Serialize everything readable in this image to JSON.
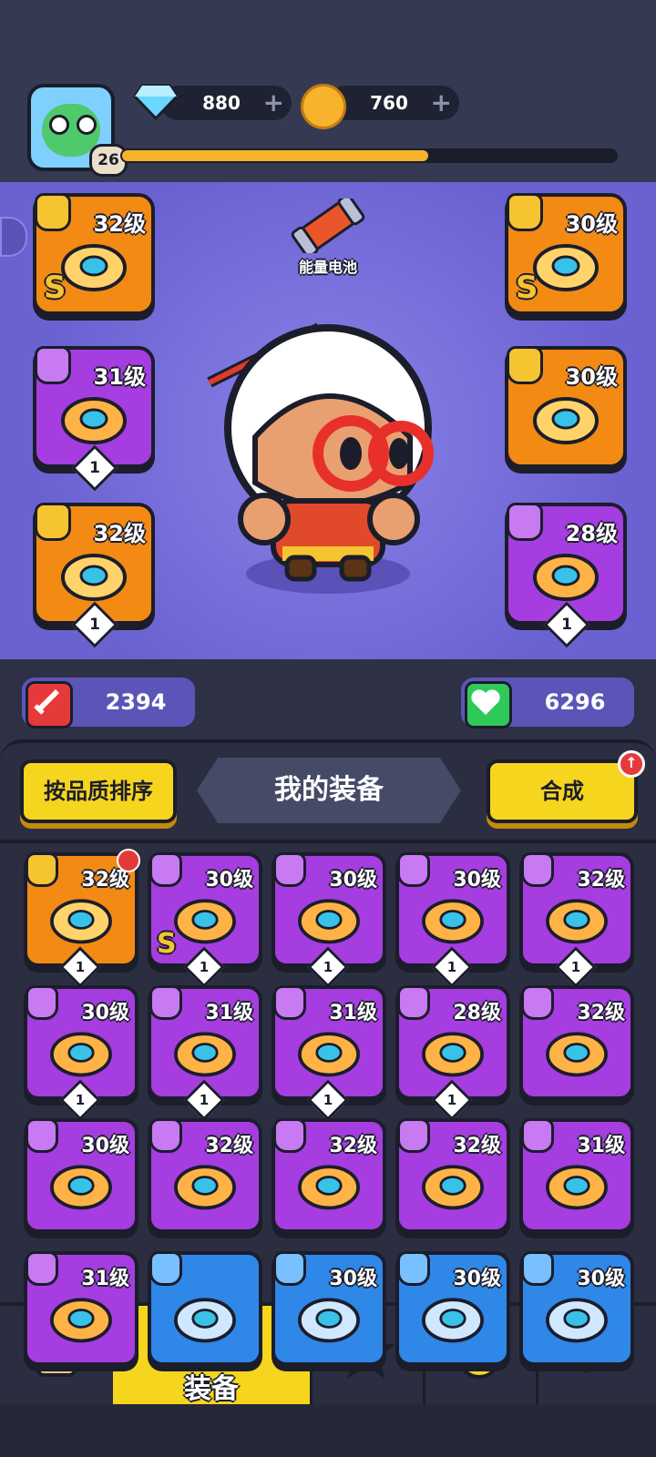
{
  "header": {
    "player_level": "26",
    "xp_fraction": 0.62,
    "gems": "880",
    "coins": "760"
  },
  "hero": {
    "battery_label": "能量电池",
    "attack": "2394",
    "health": "6296"
  },
  "equipped_left": [
    {
      "level": "32级",
      "color": "orange",
      "slot_icon": "weapon-icon",
      "item_icon": "dagger-icon",
      "grade": "S",
      "count": ""
    },
    {
      "level": "31级",
      "color": "purple",
      "slot_icon": "glove-icon",
      "item_icon": "gauntlet-icon",
      "grade": "",
      "count": "1"
    },
    {
      "level": "32级",
      "color": "orange",
      "slot_icon": "ring-slot-icon",
      "item_icon": "ring-icon",
      "grade": "",
      "count": "1"
    }
  ],
  "equipped_right": [
    {
      "level": "30级",
      "color": "orange",
      "slot_icon": "armor-icon",
      "item_icon": "leaf-armor-icon",
      "grade": "S",
      "count": ""
    },
    {
      "level": "30级",
      "color": "orange",
      "slot_icon": "belt-slot-icon",
      "item_icon": "eye-belt-icon",
      "grade": "",
      "count": ""
    },
    {
      "level": "28级",
      "color": "purple",
      "slot_icon": "boot-slot-icon",
      "item_icon": "boots-icon",
      "grade": "",
      "count": "1"
    }
  ],
  "inventory": {
    "sort_button": "按品质排序",
    "title": "我的装备",
    "merge_button": "合成",
    "merge_badge": "↑",
    "items": [
      {
        "level": "32级",
        "color": "orange",
        "slot_icon": "weapon-icon",
        "item_icon": "shotgun-icon",
        "grade": "",
        "count": "1",
        "new": true
      },
      {
        "level": "30级",
        "color": "purple",
        "slot_icon": "belt-slot-icon",
        "item_icon": "leaf-belt-icon",
        "grade": "S",
        "count": "1",
        "new": false
      },
      {
        "level": "30级",
        "color": "purple",
        "slot_icon": "armor-icon",
        "item_icon": "blue-armor-icon",
        "grade": "",
        "count": "1",
        "new": false
      },
      {
        "level": "30级",
        "color": "purple",
        "slot_icon": "armor-icon",
        "item_icon": "white-robe-icon",
        "grade": "",
        "count": "1",
        "new": false
      },
      {
        "level": "32级",
        "color": "purple",
        "slot_icon": "ring-slot-icon",
        "item_icon": "ruby-ring-icon",
        "grade": "",
        "count": "1",
        "new": false
      },
      {
        "level": "30级",
        "color": "purple",
        "slot_icon": "belt-slot-icon",
        "item_icon": "lightning-belt-icon",
        "grade": "",
        "count": "1",
        "new": false
      },
      {
        "level": "31级",
        "color": "purple",
        "slot_icon": "glove-icon",
        "item_icon": "blue-glove-icon",
        "grade": "",
        "count": "1",
        "new": false
      },
      {
        "level": "31级",
        "color": "purple",
        "slot_icon": "glove-icon",
        "item_icon": "brown-glove-icon",
        "grade": "",
        "count": "1",
        "new": false
      },
      {
        "level": "28级",
        "color": "purple",
        "slot_icon": "boot-slot-icon",
        "item_icon": "red-boots-icon",
        "grade": "",
        "count": "1",
        "new": false
      },
      {
        "level": "32级",
        "color": "purple",
        "slot_icon": "weapon-icon",
        "item_icon": "pistol-icon",
        "grade": "",
        "count": "",
        "new": false
      },
      {
        "level": "30级",
        "color": "purple",
        "slot_icon": "armor-icon",
        "item_icon": "jacket-icon",
        "grade": "",
        "count": "",
        "new": false
      },
      {
        "level": "32级",
        "color": "purple",
        "slot_icon": "ring-slot-icon",
        "item_icon": "blue-ring-icon",
        "grade": "",
        "count": "",
        "new": false
      },
      {
        "level": "32级",
        "color": "purple",
        "slot_icon": "ring-slot-icon",
        "item_icon": "red-gem-ring-icon",
        "grade": "",
        "count": "",
        "new": false
      },
      {
        "level": "32级",
        "color": "purple",
        "slot_icon": "ring-slot-icon",
        "item_icon": "teal-gem-ring-icon",
        "grade": "",
        "count": "",
        "new": false
      },
      {
        "level": "31级",
        "color": "purple",
        "slot_icon": "glove-icon",
        "item_icon": "white-glove-icon",
        "grade": "",
        "count": "",
        "new": false
      },
      {
        "level": "31级",
        "color": "purple",
        "slot_icon": "glove-icon",
        "item_icon": "glove-icon",
        "grade": "",
        "count": "",
        "new": false
      },
      {
        "level": "",
        "color": "blue",
        "slot_icon": "weapon-icon",
        "item_icon": "weapon-icon",
        "grade": "",
        "count": "",
        "new": false
      },
      {
        "level": "30级",
        "color": "blue",
        "slot_icon": "weapon-icon",
        "item_icon": "weapon-icon",
        "grade": "",
        "count": "",
        "new": false
      },
      {
        "level": "30级",
        "color": "blue",
        "slot_icon": "weapon-icon",
        "item_icon": "weapon-icon",
        "grade": "",
        "count": "",
        "new": false
      },
      {
        "level": "30级",
        "color": "blue",
        "slot_icon": "weapon-icon",
        "item_icon": "weapon-icon",
        "grade": "",
        "count": "",
        "new": false
      }
    ]
  },
  "tabs": [
    {
      "label": "",
      "icon": "shop-icon",
      "active": false
    },
    {
      "label": "装备",
      "icon": "equipment-ring-icon",
      "active": true
    },
    {
      "label": "",
      "icon": "star-icon",
      "active": false
    },
    {
      "label": "",
      "icon": "chick-egg-icon",
      "active": false
    },
    {
      "label": "",
      "icon": "capsule-icon",
      "active": false
    }
  ],
  "colors": {
    "orange": "#f28a13",
    "purple": "#a53de0",
    "blue": "#2f87e8",
    "accent_yellow": "#f6d51e"
  }
}
